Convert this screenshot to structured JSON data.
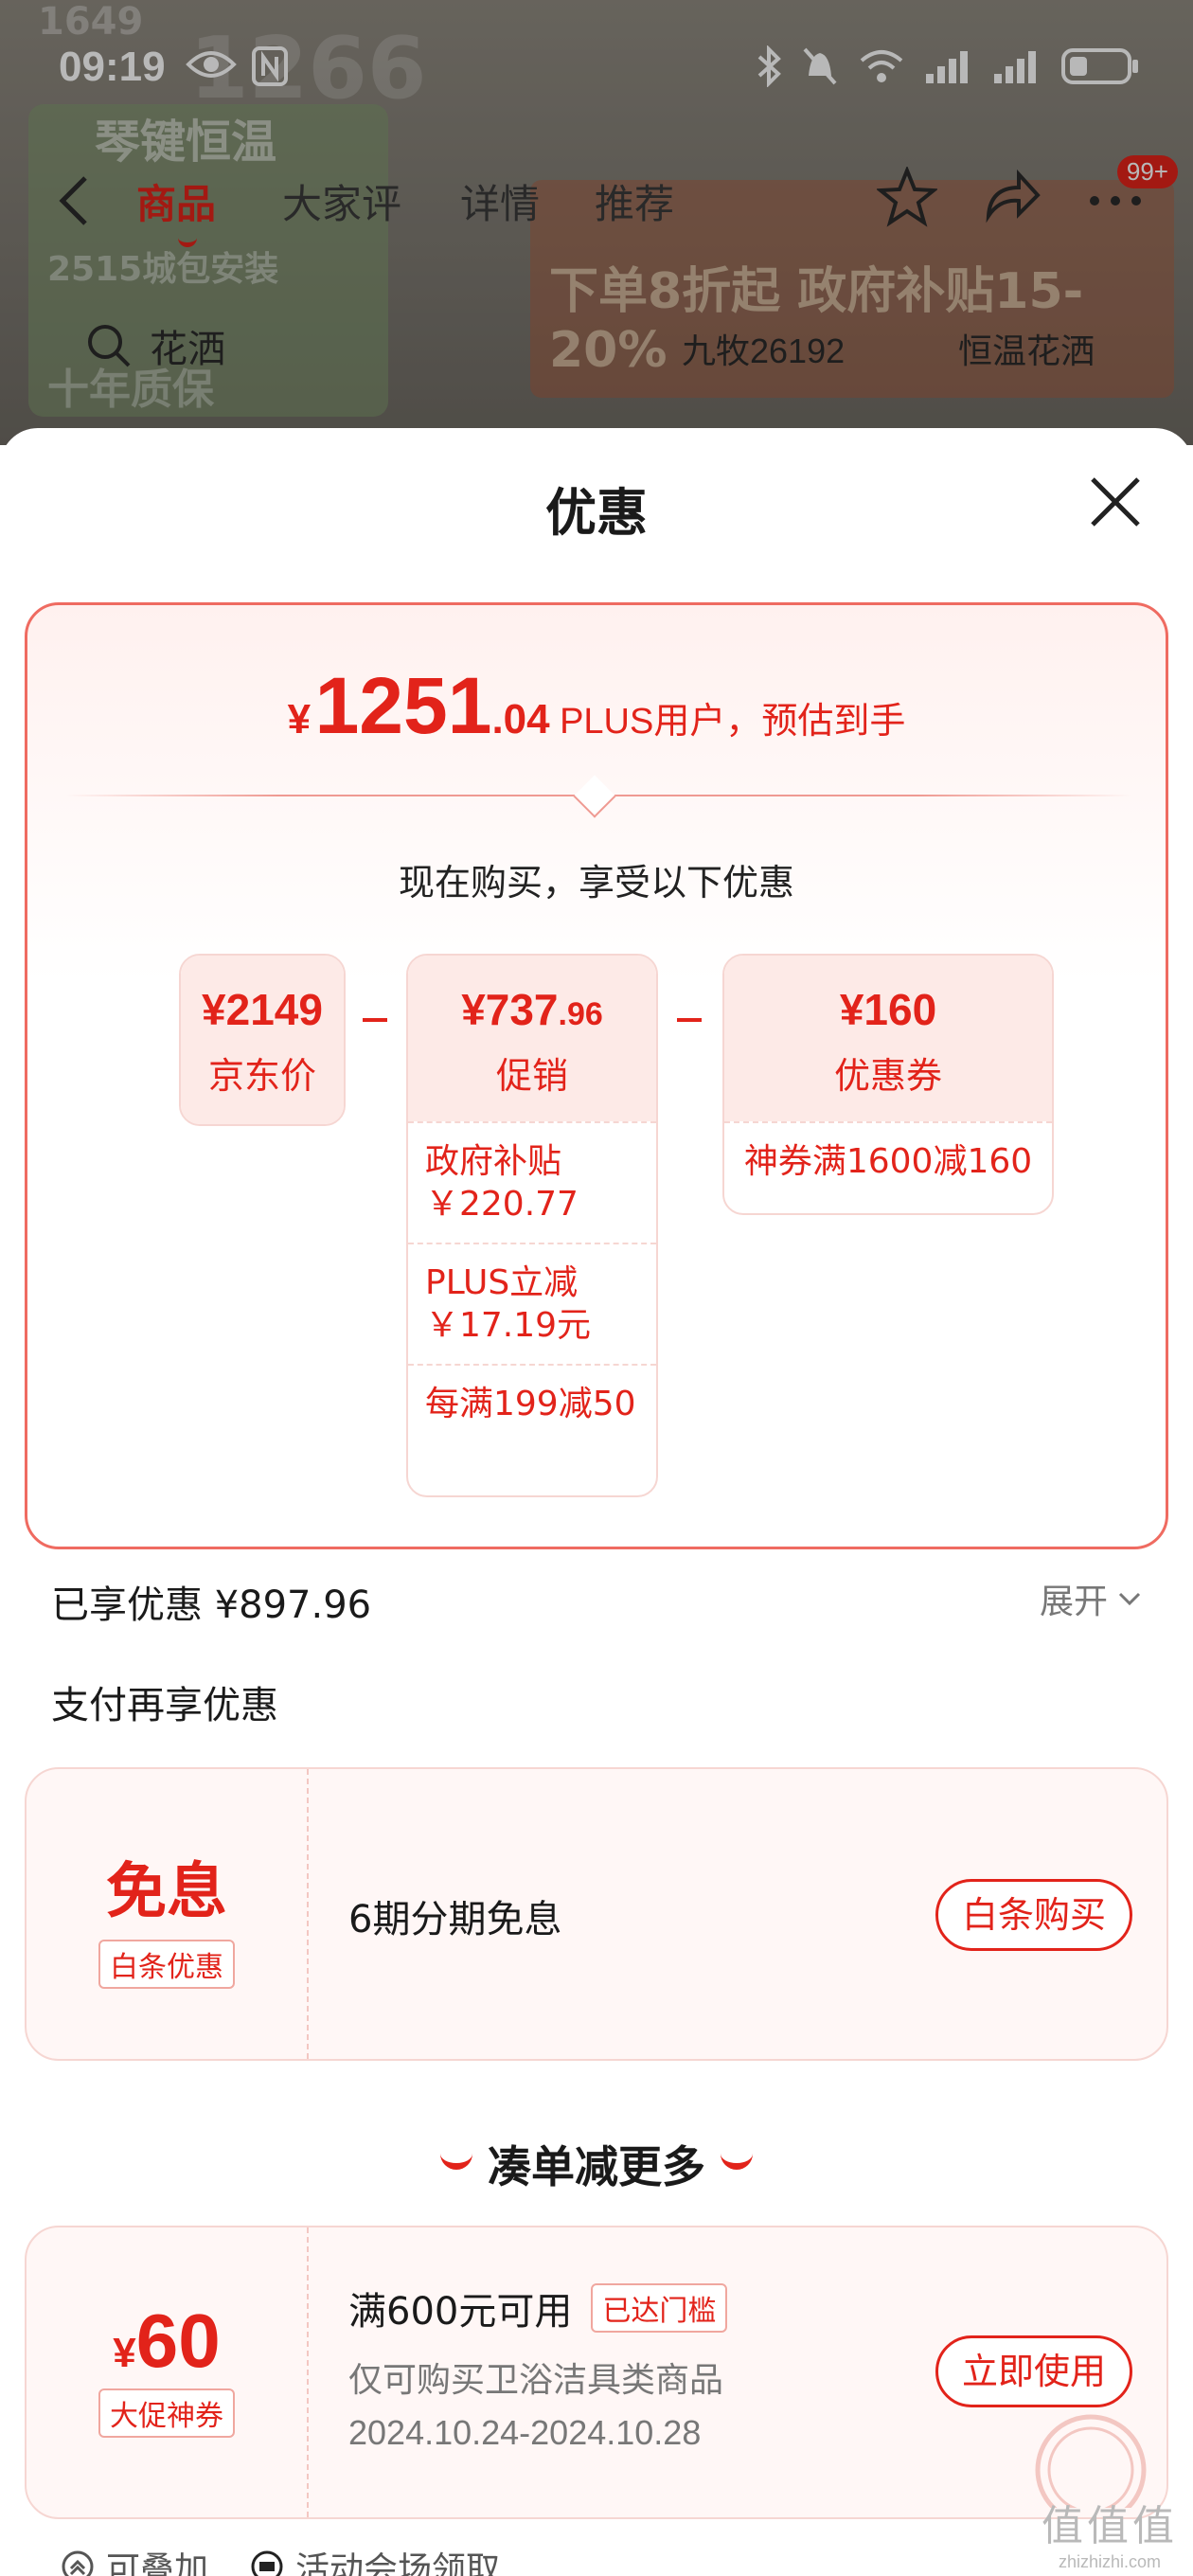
{
  "status_bar": {
    "time": "09:19"
  },
  "nav": {
    "tabs": [
      "商品",
      "大家评",
      "详情",
      "推荐"
    ],
    "badge": "99+"
  },
  "background": {
    "search_keyword": "花洒",
    "keyword2": "九牧26192",
    "keyword3": "恒温花洒",
    "ghost_texts": [
      "1649",
      "1266",
      "琴键恒温",
      "2515城包安装",
      "十年质保",
      "下单8折起 政府补贴15-20%"
    ]
  },
  "sheet": {
    "title": "优惠",
    "estimate": {
      "yen": "¥",
      "integer": "1251",
      "decimal": ".04",
      "note": "PLUS用户，预估到手"
    },
    "now_buy": "现在购买，享受以下优惠",
    "jd_price": {
      "value": "¥2149",
      "label": "京东价"
    },
    "promo": {
      "value_int": "¥737",
      "value_dec": ".96",
      "label": "促销",
      "rows": [
        {
          "line1": "政府补贴",
          "line2": "￥220.77"
        },
        {
          "line1": "PLUS立减",
          "line2": "￥17.19元"
        },
        {
          "line1": "每满199减50",
          "line2": ""
        }
      ]
    },
    "coupon_box": {
      "value": "¥160",
      "label": "优惠券",
      "rows": [
        {
          "line1": "神券满1600减160"
        }
      ]
    },
    "enjoyed": "已享优惠 ¥897.96",
    "expand": "展开",
    "pay_title": "支付再享优惠",
    "pay_coupon": {
      "title": "免息",
      "tag": "白条优惠",
      "desc": "6期分期免息",
      "button": "白条购买"
    },
    "more_title": "凑单减更多",
    "coupon2": {
      "yen": "¥",
      "amount": "60",
      "tag": "大促神券",
      "title": "满600元可用",
      "reached": "已达门槛",
      "scope": "仅可购买卫浴洁具类商品",
      "dates": "2024.10.24-2024.10.28",
      "button": "立即使用"
    },
    "footer": {
      "stackable": "可叠加",
      "source": "活动会场领取"
    }
  },
  "watermark": {
    "line1": "值值值",
    "line2": "zhizhizhi.com"
  },
  "colors": {
    "accent": "#e2231a",
    "border": "#f6d6d2"
  }
}
